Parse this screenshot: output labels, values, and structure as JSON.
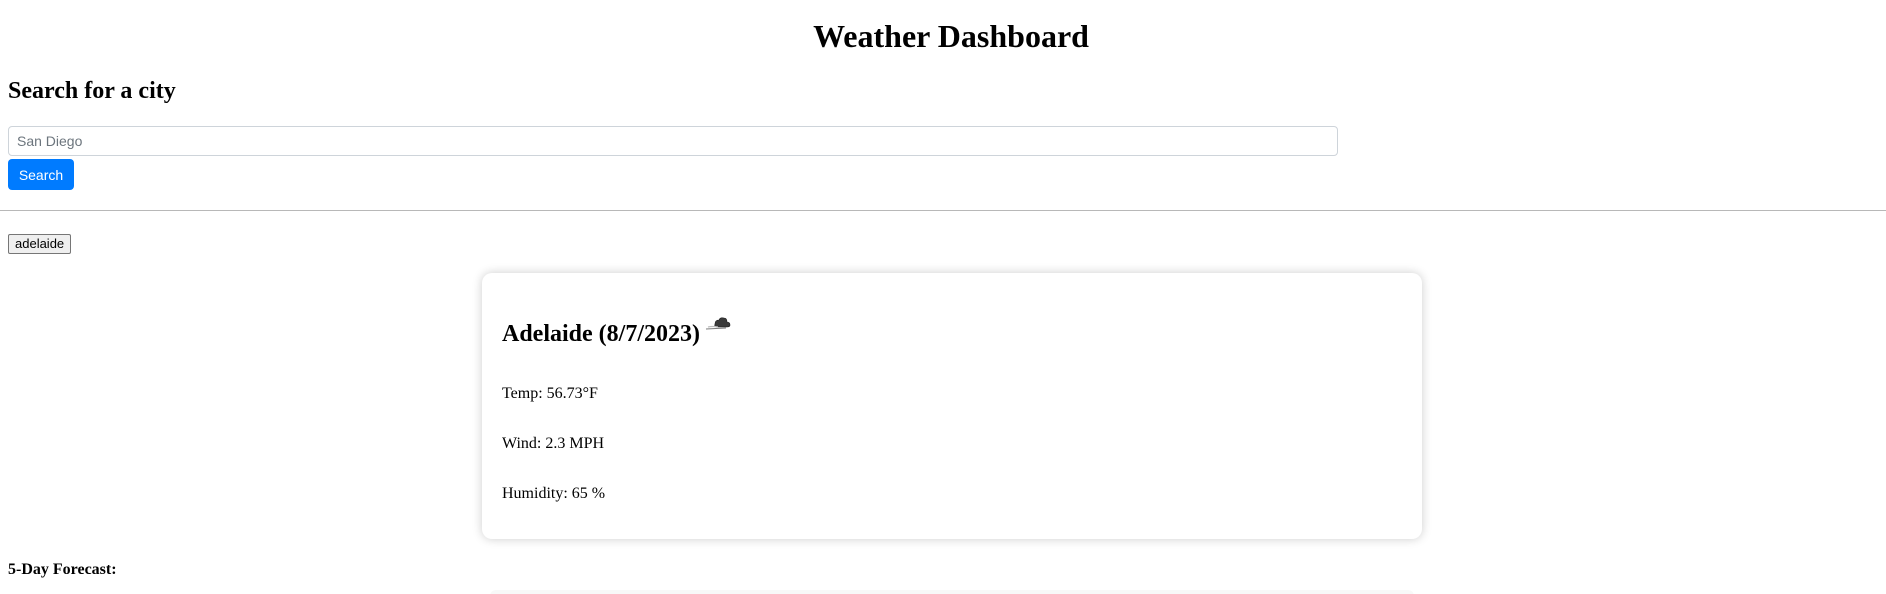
{
  "header": {
    "title": "Weather Dashboard"
  },
  "search": {
    "heading": "Search for a city",
    "placeholder": "San Diego",
    "value": "",
    "button_label": "Search",
    "accent_color": "#007bff"
  },
  "history": {
    "items": [
      {
        "label": "adelaide"
      }
    ]
  },
  "current": {
    "heading": "Adelaide (8/7/2023)",
    "icon": "cloud-icon",
    "temp": "Temp: 56.73°F",
    "wind": "Wind: 2.3 MPH",
    "humidity": "Humidity: 65 %"
  },
  "forecast": {
    "heading": "5-Day Forecast:"
  }
}
